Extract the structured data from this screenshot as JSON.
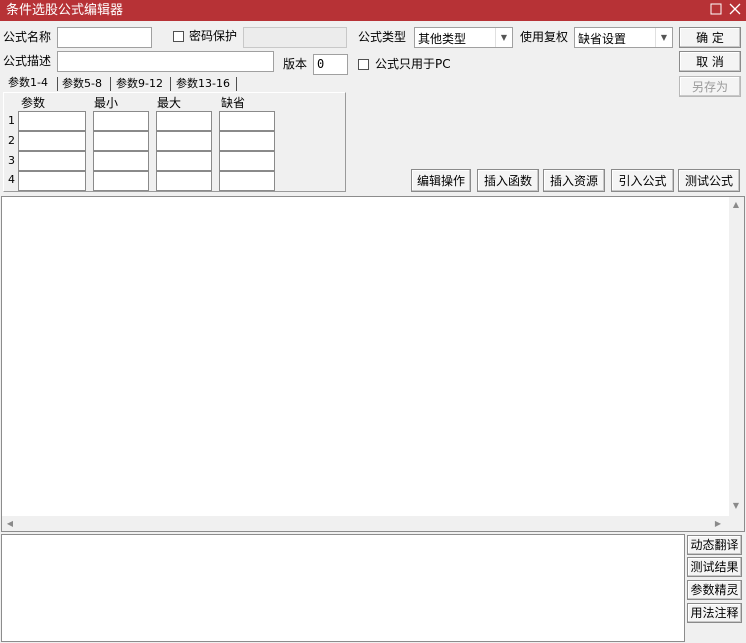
{
  "window": {
    "title": "条件选股公式编辑器",
    "maximize_icon": "maximize-icon",
    "close_icon": "close-icon",
    "titlebar_color": "#b73236"
  },
  "form": {
    "name_label": "公式名称",
    "name_value": "",
    "password_label": "密码保护",
    "password_checked": false,
    "password_value": "",
    "desc_label": "公式描述",
    "desc_value": "",
    "version_label": "版本",
    "version_value": "0",
    "pc_only_label": "公式只用于PC",
    "pc_only_checked": false,
    "type_label": "公式类型",
    "type_value": "其他类型",
    "rights_label": "使用复权",
    "rights_value": "缺省设置"
  },
  "buttons": {
    "ok": "确  定",
    "cancel": "取  消",
    "save_as": "另存为"
  },
  "param_tabs": [
    "参数1-4",
    "参数5-8",
    "参数9-12",
    "参数13-16"
  ],
  "params": {
    "headers": [
      "参数",
      "最小",
      "最大",
      "缺省"
    ],
    "rows": [
      {
        "num": "1",
        "name": "",
        "min": "",
        "max": "",
        "default": ""
      },
      {
        "num": "2",
        "name": "",
        "min": "",
        "max": "",
        "default": ""
      },
      {
        "num": "3",
        "name": "",
        "min": "",
        "max": "",
        "default": ""
      },
      {
        "num": "4",
        "name": "",
        "min": "",
        "max": "",
        "default": ""
      }
    ]
  },
  "toolbar": [
    "编辑操作",
    "插入函数",
    "插入资源",
    "引入公式",
    "测试公式"
  ],
  "editor": {
    "content": ""
  },
  "output": {
    "content": ""
  },
  "side_buttons": [
    "动态翻译",
    "测试结果",
    "参数精灵",
    "用法注释"
  ]
}
